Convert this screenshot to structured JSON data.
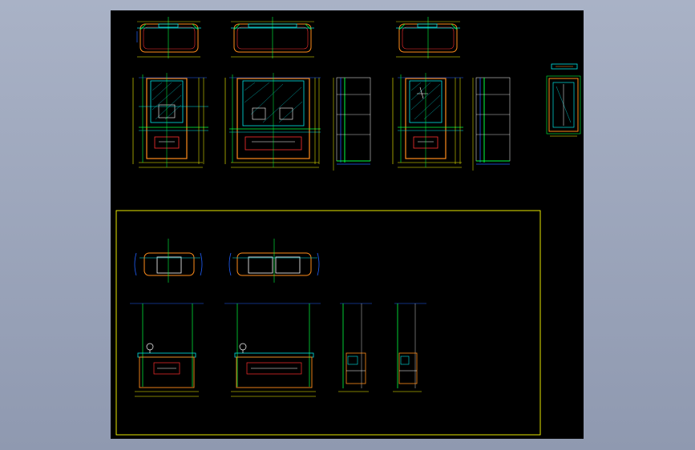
{
  "viewport": {
    "background_color": "#9aa3b8",
    "drawing_background_color": "#000000"
  },
  "colors": {
    "frame": "#ffff00",
    "cyan": "#00e5e5",
    "green": "#00ff40",
    "orange": "#ff8c1a",
    "red": "#ff3030",
    "blue": "#2060ff",
    "white": "#ffffff",
    "yellow": "#ffff00",
    "magenta": "#ff40ff"
  },
  "sheets": {
    "upper_set": "upper-drawings-group",
    "lower_set": "lower-layout-frame"
  }
}
